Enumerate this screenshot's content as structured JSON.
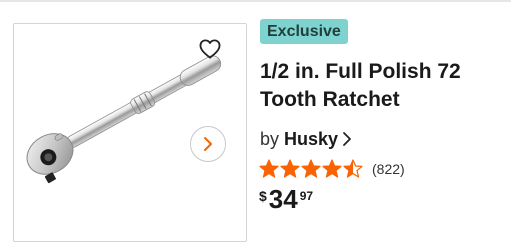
{
  "product": {
    "badge": "Exclusive",
    "title": "1/2 in. Full Polish 72 Tooth Ratchet",
    "brand_prefix": "by",
    "brand_name": "Husky",
    "rating": 4.5,
    "rating_max": 5,
    "review_count": "(822)",
    "price": {
      "currency": "$",
      "dollars": "34",
      "cents": "97"
    }
  },
  "icons": {
    "favorite": "heart-outline-icon",
    "next_image": "chevron-right-icon",
    "brand_link": "chevron-right-icon",
    "rating_star": "star-icon"
  },
  "colors": {
    "badge_bg": "#7fd3ce",
    "star": "#f96302",
    "next_arrow": "#f96302"
  }
}
